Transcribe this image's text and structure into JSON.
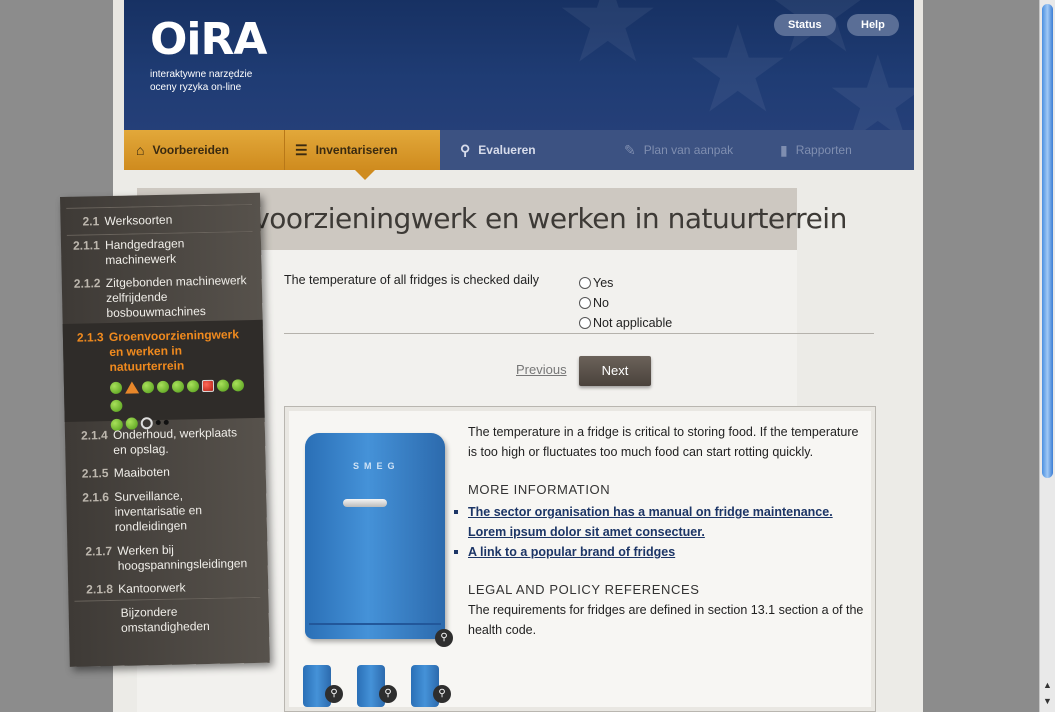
{
  "header": {
    "logo": "OiRA",
    "logo_sub_1": "interaktywne narzędzie",
    "logo_sub_2": "oceny ryzyka on-line",
    "status_label": "Status",
    "help_label": "Help"
  },
  "tabs": [
    {
      "label": "Voorbereiden",
      "icon": "home-icon"
    },
    {
      "label": "Inventariseren",
      "icon": "checklist-icon"
    },
    {
      "label": "Evalueren",
      "icon": "search-icon"
    },
    {
      "label": "Plan van aanpak",
      "icon": "pencil-icon"
    },
    {
      "label": "Rapporten",
      "icon": "document-icon"
    }
  ],
  "page_title": "Groenvoorzieningwerk en werken in natuurterrein",
  "question": {
    "text": "The temperature of all fridges is checked daily",
    "options": [
      "Yes",
      "No",
      "Not applicable"
    ]
  },
  "nav_buttons": {
    "previous": "Previous",
    "next": "Next"
  },
  "info": {
    "fridge_brand": "SMEG",
    "description": "The temperature in a fridge is critical to storing food. If the temperature is too high or fluctuates too much food can start rotting quickly.",
    "more_info_heading": "MORE INFORMATION",
    "links": [
      "The sector organisation has a manual on fridge maintenance.",
      "Lorem ipsum dolor sit amet consectuer.",
      "A link to a popular brand of fridges"
    ],
    "legal_heading": "LEGAL AND POLICY REFERENCES",
    "legal_text": "The requirements for fridges are defined in section 13.1 section a of the health code."
  },
  "sidebar": {
    "items": [
      {
        "num": "2.1",
        "label": "Werksoorten"
      },
      {
        "num": "2.1.1",
        "label": "Handgedragen machinewerk"
      },
      {
        "num": "2.1.2",
        "label": "Zitgebonden machinewerk zelfrijdende bosbouwmachines"
      },
      {
        "num": "2.1.3",
        "label": "Groenvoorzieningwerk en werken in natuurterrein"
      },
      {
        "num": "2.1.4",
        "label": "Onderhoud, werkplaats en opslag."
      },
      {
        "num": "2.1.5",
        "label": "Maaiboten"
      },
      {
        "num": "2.1.6",
        "label": "Surveillance, inventarisatie en rondleidingen"
      },
      {
        "num": "2.1.7",
        "label": "Werken bij hoogspanningsleidingen"
      },
      {
        "num": "2.1.8",
        "label": "Kantoorwerk"
      },
      {
        "num": "",
        "label": "Bijzondere omstandigheden"
      }
    ],
    "active_status_dots": [
      "green",
      "warning",
      "green",
      "green",
      "green",
      "green",
      "red",
      "green",
      "green",
      "green",
      "green",
      "green",
      "current",
      "small",
      "small"
    ]
  },
  "colors": {
    "header_blue": "#1f3c74",
    "tab_active": "#e2a83a",
    "sidebar_active": "#f08a1e",
    "link": "#1c3566"
  }
}
